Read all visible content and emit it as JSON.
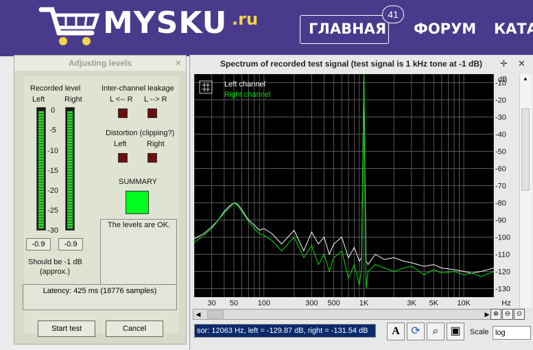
{
  "site": {
    "logo_main": "MYSKU",
    "logo_suffix": ".ru",
    "nav": [
      {
        "label": "ГЛАВНАЯ"
      },
      {
        "label": "ФОРУМ"
      },
      {
        "label": "КАТА"
      }
    ],
    "badge_count": "41",
    "colors": {
      "header": "#4a3a8c",
      "logo_accent": "#f3d54a"
    }
  },
  "levels_window": {
    "title": "Adjusting levels",
    "recorded_level": "Recorded level",
    "left": "Left",
    "right": "Right",
    "scale": [
      "0",
      "-5",
      "-10",
      "-15",
      "-20",
      "-25",
      "-30"
    ],
    "left_value": "-0.9",
    "right_value": "-0.9",
    "left_level_db": -0.9,
    "right_level_db": -0.9,
    "should_be_line1": "Should be  -1 dB",
    "should_be_line2": "(approx.)",
    "leakage_title": "Inter-channel leakage",
    "leak_lr": "L <-- R",
    "leak_rl": "L --> R",
    "distortion_title": "Distortion (clipping?)",
    "dist_left": "Left",
    "dist_right": "Right",
    "summary": "SUMMARY",
    "status_text": "The levels are OK.",
    "latency": "Latency: 425 ms (18776 samples)",
    "start_button": "Start test",
    "cancel_button": "Cancel"
  },
  "spectrum_window": {
    "title": "Spectrum of recorded test signal (test signal is 1 kHz tone at -1 dB)",
    "readout": "sor:  12063 Hz,  left = -129.87 dB,  right = -131.54 dB",
    "scale_label": "Scale",
    "scale_value": "log",
    "icons": [
      "font-icon",
      "refresh-icon",
      "zoom-search-icon",
      "save-icon"
    ]
  },
  "chart_data": {
    "type": "line",
    "title": "Spectrum of recorded test signal (test signal is 1 kHz tone at -1 dB)",
    "xscale": "log",
    "xlim": [
      20,
      20000
    ],
    "ylim": [
      -135,
      -5
    ],
    "x_ticks": [
      "30",
      "50",
      "100",
      "300",
      "500",
      "1K",
      "3K",
      "5K",
      "10K",
      "Hz"
    ],
    "x_tick_values": [
      30,
      50,
      100,
      300,
      500,
      1000,
      3000,
      5000,
      10000
    ],
    "y_unit": "dB",
    "y_ticks": [
      "-10",
      "-20",
      "-30",
      "-40",
      "-50",
      "-60",
      "-70",
      "-80",
      "-90",
      "-100",
      "-110",
      "-120",
      "-130"
    ],
    "y_tick_values": [
      -10,
      -20,
      -30,
      -40,
      -50,
      -60,
      -70,
      -80,
      -90,
      -100,
      -110,
      -120,
      -130
    ],
    "grid": true,
    "legend_position": "top-left",
    "series": [
      {
        "name": "Left channel",
        "color": "#ffffff",
        "x": [
          20,
          25,
          30,
          35,
          40,
          45,
          50,
          55,
          60,
          70,
          80,
          90,
          100,
          120,
          150,
          200,
          250,
          300,
          350,
          400,
          450,
          500,
          600,
          700,
          800,
          900,
          950,
          1000,
          1050,
          1100,
          1300,
          1600,
          2000,
          2500,
          3000,
          4000,
          5000,
          6000,
          8000,
          10000,
          12000,
          15000,
          20000
        ],
        "y": [
          -101,
          -98,
          -94,
          -90,
          -85,
          -82,
          -80,
          -81,
          -84,
          -90,
          -93,
          -96,
          -95,
          -98,
          -104,
          -96,
          -108,
          -97,
          -104,
          -100,
          -110,
          -104,
          -100,
          -112,
          -106,
          -114,
          -112,
          -4,
          -114,
          -116,
          -110,
          -113,
          -112,
          -114,
          -115,
          -117,
          -116,
          -118,
          -119,
          -120,
          -121,
          -120,
          -118
        ]
      },
      {
        "name": "Right channel",
        "color": "#00e000",
        "x": [
          20,
          25,
          30,
          35,
          40,
          45,
          50,
          55,
          60,
          70,
          80,
          90,
          100,
          120,
          150,
          200,
          250,
          300,
          350,
          400,
          450,
          500,
          600,
          700,
          800,
          900,
          950,
          1000,
          1050,
          1100,
          1300,
          1600,
          2000,
          2500,
          3000,
          4000,
          5000,
          6000,
          8000,
          10000,
          12000,
          15000,
          20000
        ],
        "y": [
          -103,
          -99,
          -95,
          -90,
          -86,
          -83,
          -80,
          -82,
          -85,
          -91,
          -95,
          -98,
          -99,
          -102,
          -108,
          -100,
          -112,
          -105,
          -116,
          -110,
          -120,
          -112,
          -108,
          -124,
          -116,
          -128,
          -118,
          -4,
          -130,
          -120,
          -116,
          -118,
          -120,
          -118,
          -117,
          -122,
          -119,
          -121,
          -120,
          -122,
          -121,
          -123,
          -120
        ]
      }
    ]
  }
}
